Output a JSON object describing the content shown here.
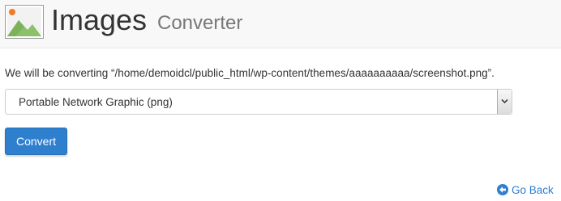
{
  "header": {
    "title": "Images",
    "subtitle": "Converter",
    "icon": "image-picture-icon"
  },
  "main": {
    "message": "We will be converting “/home/demoidcl/public_html/wp-content/themes/aaaaaaaaaa/screenshot.png”.",
    "format_select": {
      "selected": "Portable Network Graphic (png)"
    },
    "convert_label": "Convert"
  },
  "footer": {
    "go_back_label": "Go Back",
    "go_back_icon": "arrow-circle-left-icon"
  },
  "colors": {
    "accent": "#2f7fcf",
    "icon_green": "#8dc06a",
    "icon_orange": "#f07a2b",
    "header_bg": "#f8f8f8"
  }
}
